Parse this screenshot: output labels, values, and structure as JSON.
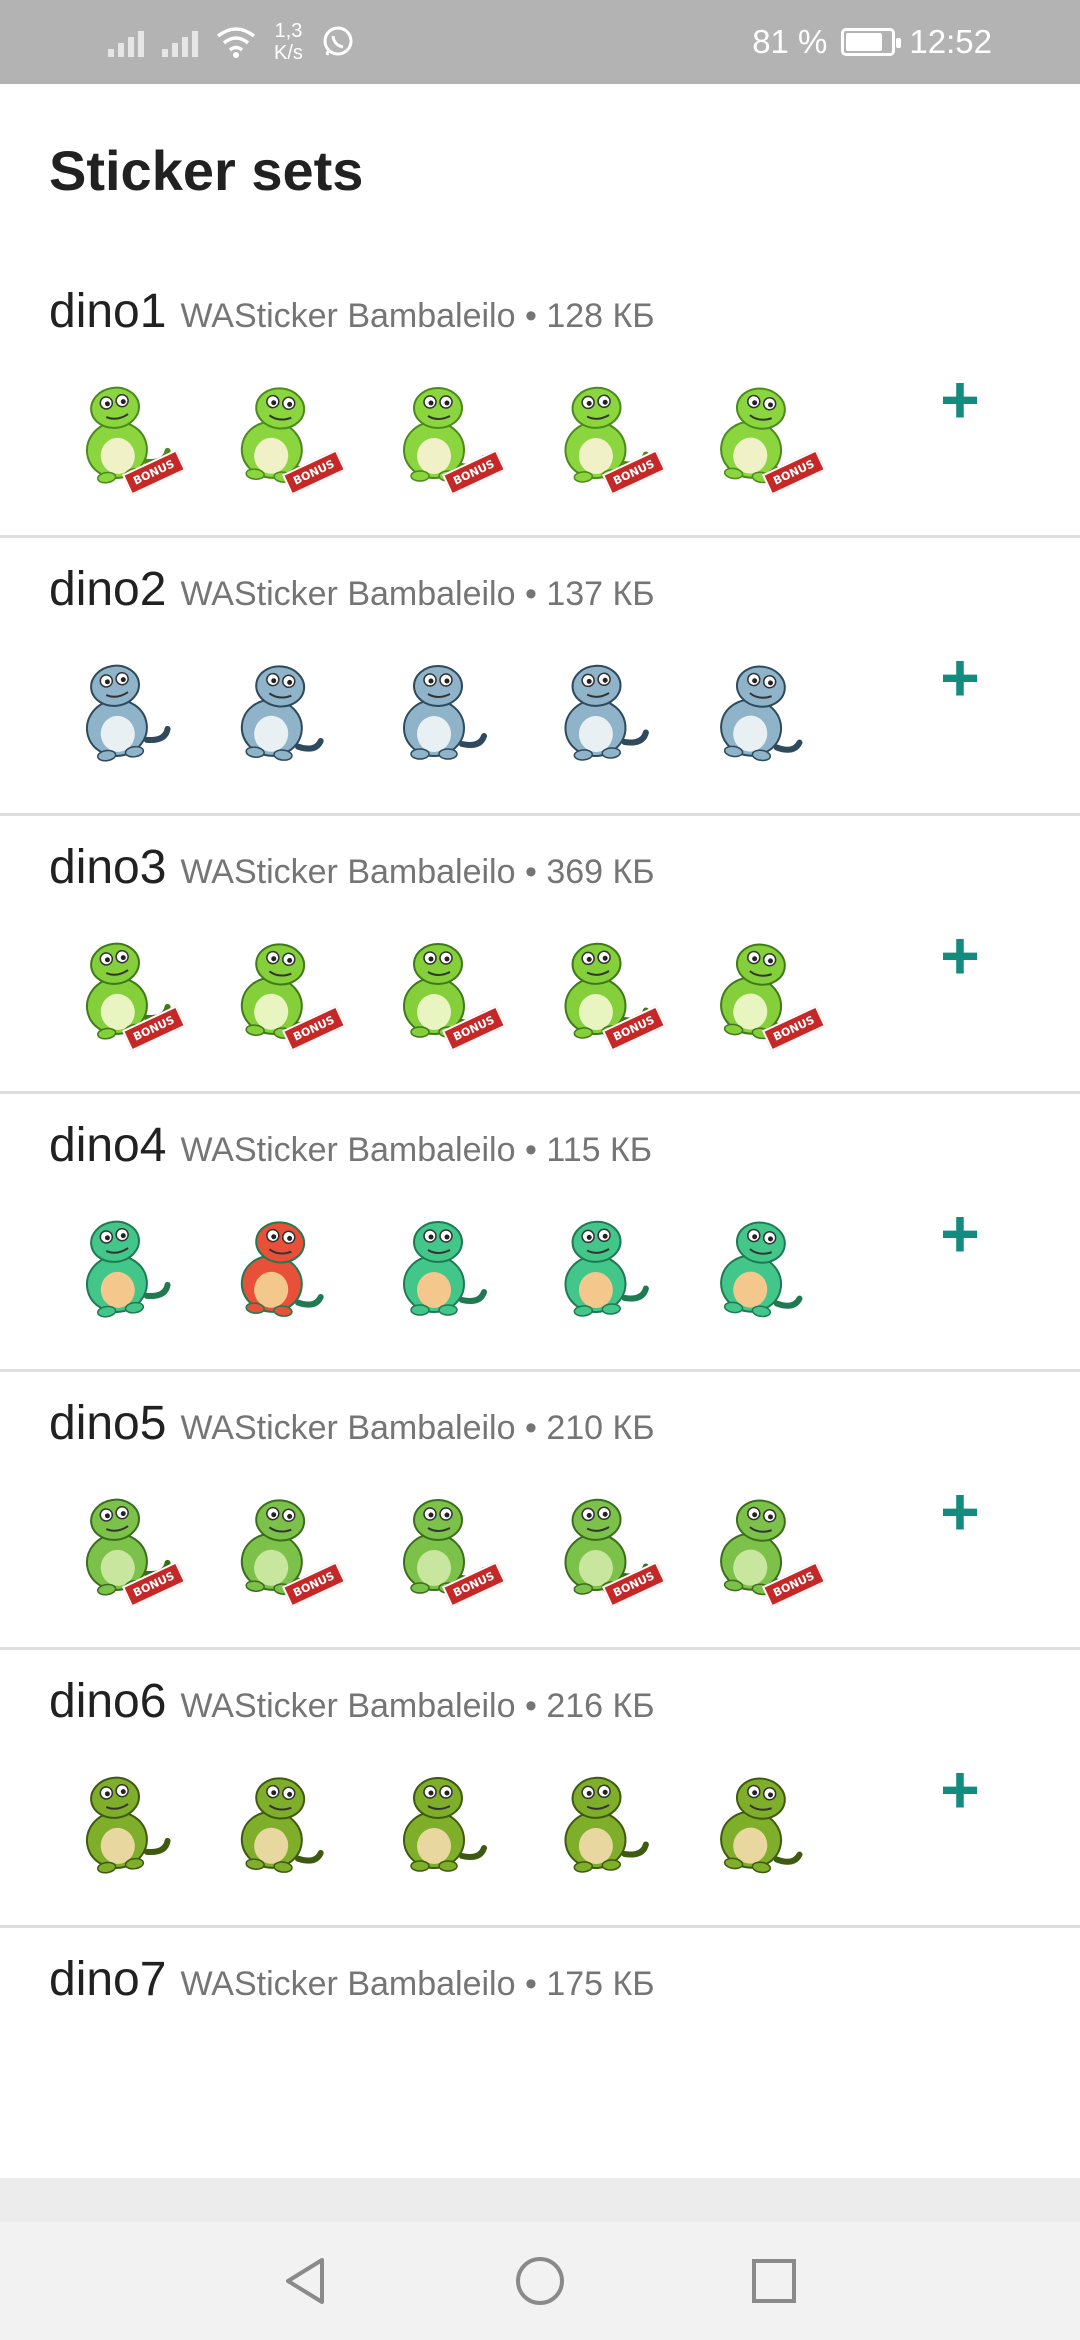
{
  "status_bar": {
    "speed_value": "1,3",
    "speed_unit": "K/s",
    "battery": "81 %",
    "battery_level": 0.81,
    "time": "12:52"
  },
  "page": {
    "title": "Sticker sets"
  },
  "sets": [
    {
      "name": "dino1",
      "meta": "WASticker Bambaleilo • 128 КБ",
      "bonus": true,
      "style": "lightgreen"
    },
    {
      "name": "dino2",
      "meta": "WASticker Bambaleilo • 137 КБ",
      "bonus": false,
      "style": "blue"
    },
    {
      "name": "dino3",
      "meta": "WASticker Bambaleilo • 369 КБ",
      "bonus": true,
      "style": "cartoon"
    },
    {
      "name": "dino4",
      "meta": "WASticker Bambaleilo • 115 КБ",
      "bonus": false,
      "style": "teal"
    },
    {
      "name": "dino5",
      "meta": "WASticker Bambaleilo • 210 КБ",
      "bonus": true,
      "style": "trex"
    },
    {
      "name": "dino6",
      "meta": "WASticker Bambaleilo • 216 КБ",
      "bonus": false,
      "style": "olive"
    },
    {
      "name": "dino7",
      "meta": "WASticker Bambaleilo • 175 КБ",
      "bonus": false,
      "style": "none"
    }
  ],
  "labels": {
    "bonus": "BONUS",
    "add": "+"
  },
  "colors": {
    "accent": "#128c7e",
    "status_bar": "#b3b3b3"
  },
  "icons": {
    "add": "plus-icon",
    "nav_back": "back-triangle-icon",
    "nav_home": "home-circle-icon",
    "nav_recent": "recent-square-icon"
  }
}
